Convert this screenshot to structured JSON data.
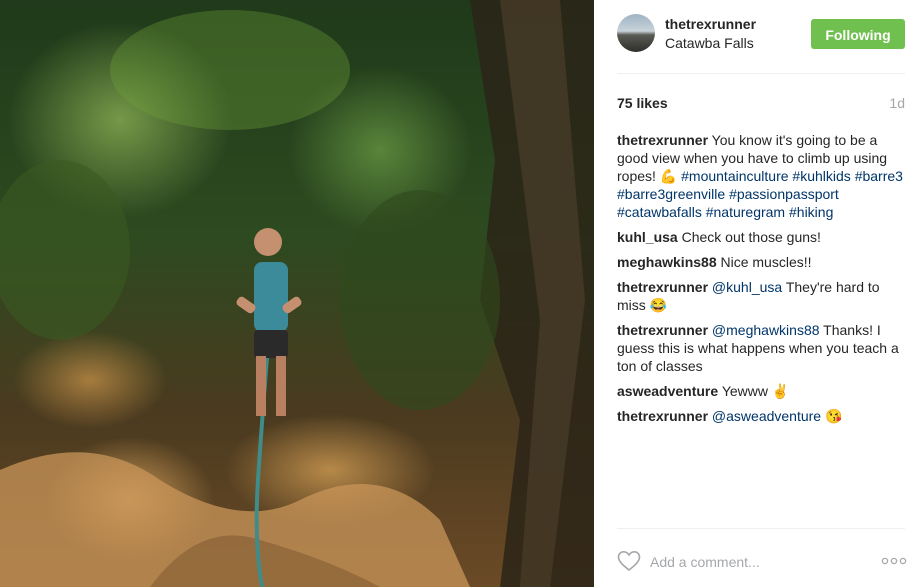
{
  "post": {
    "username": "thetrexrunner",
    "location": "Catawba Falls",
    "follow_label": "Following",
    "likes": "75 likes",
    "time_ago": "1d"
  },
  "caption": {
    "user": "thetrexrunner",
    "text": "You know it's going to be a good view when you have to climb up using ropes! 💪",
    "hashtags": [
      "#mountainculture",
      "#kuhlkids",
      "#barre3",
      "#barre3greenville",
      "#passionpassport",
      "#catawbafalls",
      "#naturegram",
      "#hiking"
    ]
  },
  "comments": [
    {
      "user": "kuhl_usa",
      "mention": "",
      "text": "Check out those guns!"
    },
    {
      "user": "meghawkins88",
      "mention": "",
      "text": "Nice muscles!!"
    },
    {
      "user": "thetrexrunner",
      "mention": "@kuhl_usa",
      "text": "They're hard to miss 😂"
    },
    {
      "user": "thetrexrunner",
      "mention": "@meghawkins88",
      "text": "Thanks! I guess this is what happens when you teach a ton of classes"
    },
    {
      "user": "asweadventure",
      "mention": "",
      "text": "Yewww ✌"
    },
    {
      "user": "thetrexrunner",
      "mention": "@asweadventure",
      "text": "😘"
    }
  ],
  "add_comment": {
    "placeholder": "Add a comment..."
  },
  "icons": {
    "like": "heart-icon",
    "more": "more-options-icon"
  },
  "colors": {
    "follow_button": "#70c050",
    "link": "#003569",
    "muted": "#a5a7aa"
  }
}
